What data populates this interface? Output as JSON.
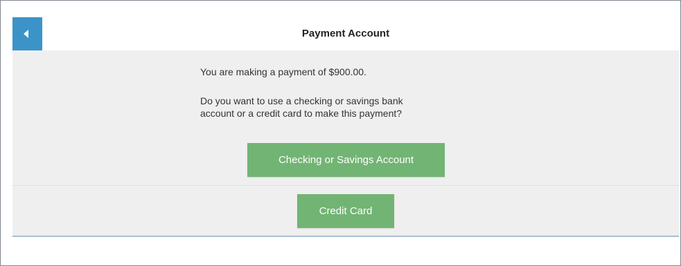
{
  "header": {
    "title": "Payment Account",
    "back_icon": "back-arrow-icon",
    "accent_color": "#3c93c8"
  },
  "main": {
    "payment_message": "You are making a payment of $900.00.",
    "question_line1": "Do you want to use a checking or savings bank",
    "question_line2": "account or a credit card to make this payment?"
  },
  "buttons": {
    "checking_label": "Checking or Savings Account",
    "credit_label": "Credit Card",
    "button_color": "#72b474"
  }
}
